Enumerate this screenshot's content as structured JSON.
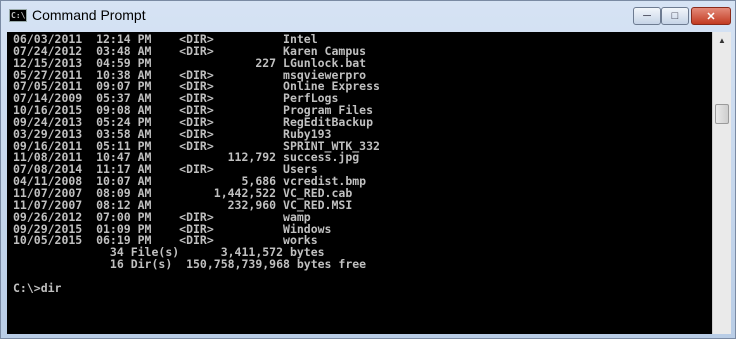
{
  "window": {
    "title": "Command Prompt",
    "icon": "console-icon",
    "icon_glyph": "C:\\",
    "minimize_glyph": "─",
    "maximize_glyph": "□",
    "close_glyph": "✕"
  },
  "console": {
    "lines": [
      "06/03/2011  12:14 PM    <DIR>          Intel",
      "07/24/2012  03:48 AM    <DIR>          Karen Campus",
      "12/15/2013  04:59 PM               227 LGunlock.bat",
      "05/27/2011  10:38 AM    <DIR>          msqviewerpro",
      "07/05/2011  09:07 PM    <DIR>          Online Express",
      "07/14/2009  05:37 AM    <DIR>          PerfLogs",
      "10/16/2015  09:08 AM    <DIR>          Program Files",
      "09/24/2013  05:24 PM    <DIR>          RegEditBackup",
      "03/29/2013  03:58 AM    <DIR>          Ruby193",
      "09/16/2011  05:11 PM    <DIR>          SPRINT_WTK_332",
      "11/08/2011  10:47 AM           112,792 success.jpg",
      "07/08/2014  11:17 AM    <DIR>          Users",
      "04/11/2008  10:07 AM             5,686 vcredist.bmp",
      "11/07/2007  08:09 AM         1,442,522 VC_RED.cab",
      "11/07/2007  08:12 AM           232,960 VC_RED.MSI",
      "09/26/2012  07:00 PM    <DIR>          wamp",
      "09/29/2015  01:09 PM    <DIR>          Windows",
      "10/05/2015  06:19 PM    <DIR>          works",
      "              34 File(s)      3,411,572 bytes",
      "              16 Dir(s)  150,758,739,968 bytes free",
      "",
      "C:\\>dir"
    ]
  },
  "scrollbar": {
    "up_arrow_glyph": "▲"
  },
  "colors": {
    "console_background": "#000000",
    "console_text": "#c0c0c0",
    "close_button": "#c23b22"
  }
}
